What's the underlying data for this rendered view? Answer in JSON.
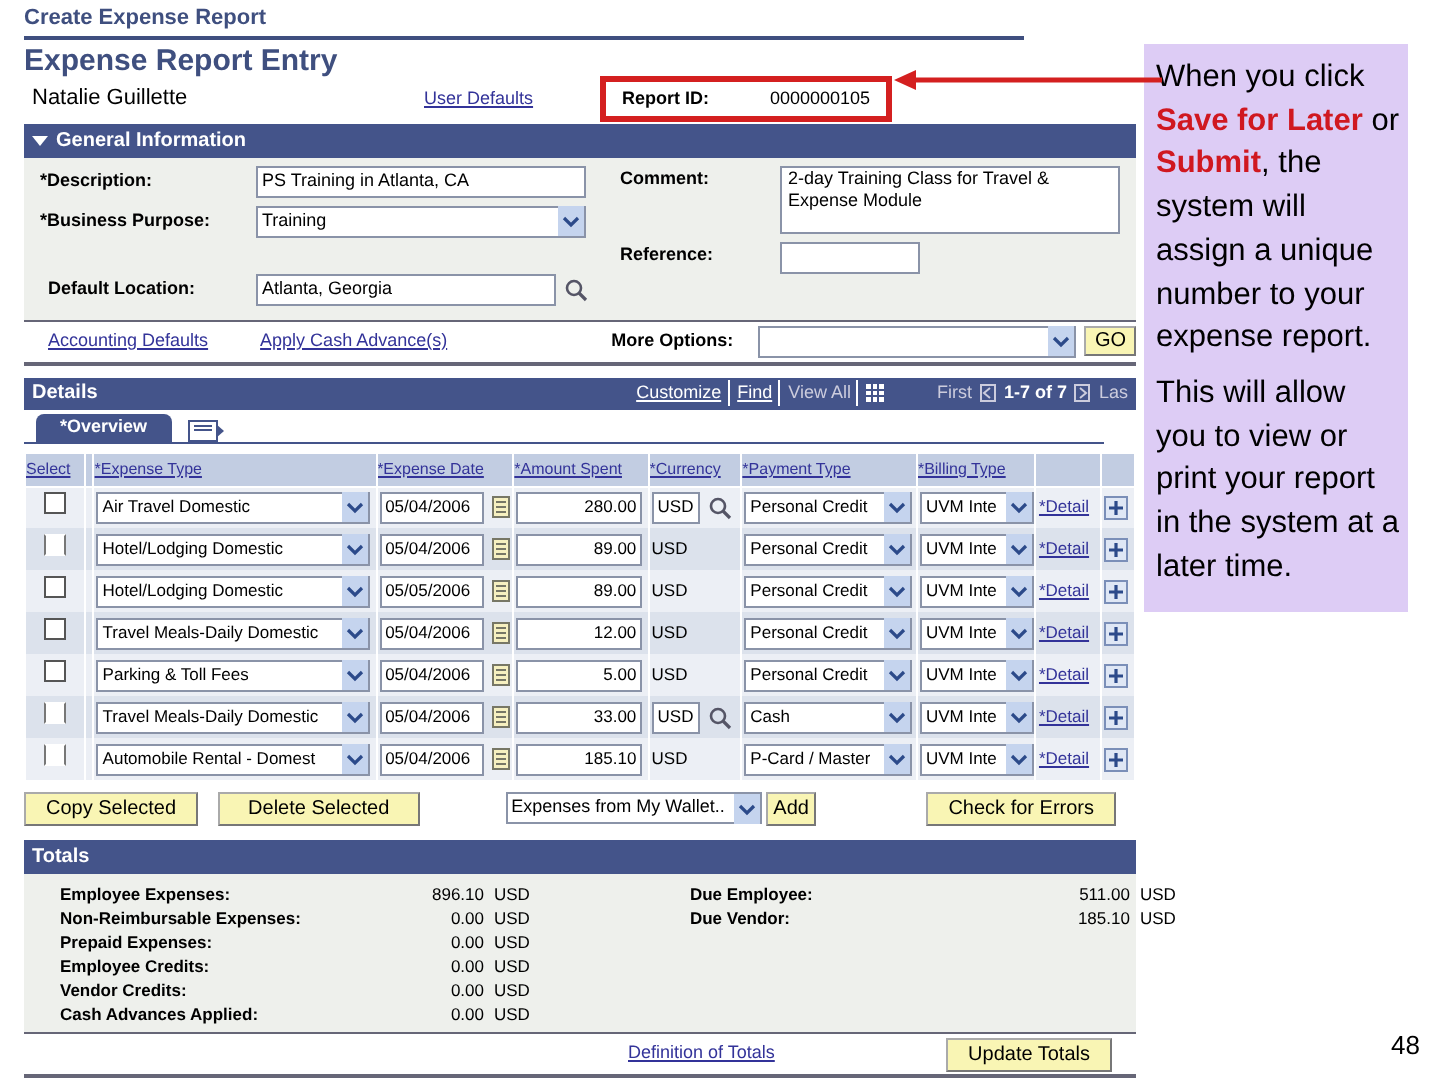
{
  "header": {
    "breadcrumb": "Create Expense Report",
    "title": "Expense Report Entry",
    "employee": "Natalie Guillette",
    "user_defaults": "User Defaults",
    "report_id_label": "Report ID:",
    "report_id": "0000000105"
  },
  "general": {
    "title": "General Information",
    "expanded": true,
    "description_label": "*Description:",
    "description": "PS Training in Atlanta, CA",
    "purpose_label": "*Business Purpose:",
    "purpose": "Training",
    "location_label": "Default Location:",
    "location": "Atlanta, Georgia",
    "comment_label": "Comment:",
    "comment": "2-day Training Class for Travel & Expense Module",
    "reference_label": "Reference:"
  },
  "options": {
    "links": [
      "Accounting Defaults",
      "Apply Cash Advance(s)"
    ],
    "more_options_label": "More Options:",
    "go": "GO"
  },
  "details": {
    "title": "Details",
    "nav": [
      "Customize",
      "Find",
      "View All"
    ],
    "first": "First",
    "range": "1-7 of 7",
    "last": "Las",
    "tabs": [
      {
        "label": "*Overview",
        "selected": true
      }
    ],
    "columns": [
      "Select",
      "*Expense Type",
      "*Expense Date",
      "*Amount Spent",
      "*Currency",
      "*Payment Type",
      "*Billing Type"
    ],
    "rows": [
      {
        "checked": false,
        "disabled": false,
        "type": "Air Travel Domestic",
        "date": "05/04/2006",
        "amount": "280.00",
        "currency": "USD",
        "currency_editable": true,
        "payment": "Personal Credit",
        "billing": "UVM Inte",
        "detail": "*Detail"
      },
      {
        "checked": false,
        "disabled": true,
        "type": "Hotel/Lodging Domestic",
        "date": "05/04/2006",
        "amount": "89.00",
        "currency": "USD",
        "currency_editable": false,
        "payment": "Personal Credit",
        "billing": "UVM Inte",
        "detail": "*Detail"
      },
      {
        "checked": false,
        "disabled": false,
        "type": "Hotel/Lodging Domestic",
        "date": "05/05/2006",
        "amount": "89.00",
        "currency": "USD",
        "currency_editable": false,
        "payment": "Personal Credit",
        "billing": "UVM Inte",
        "detail": "*Detail"
      },
      {
        "checked": false,
        "disabled": false,
        "type": "Travel Meals-Daily Domestic",
        "date": "05/04/2006",
        "amount": "12.00",
        "currency": "USD",
        "currency_editable": false,
        "payment": "Personal Credit",
        "billing": "UVM Inte",
        "detail": "*Detail"
      },
      {
        "checked": false,
        "disabled": false,
        "type": "Parking & Toll Fees",
        "date": "05/04/2006",
        "amount": "5.00",
        "currency": "USD",
        "currency_editable": false,
        "payment": "Personal Credit",
        "billing": "UVM Inte",
        "detail": "*Detail"
      },
      {
        "checked": false,
        "disabled": true,
        "type": "Travel Meals-Daily Domestic",
        "date": "05/04/2006",
        "amount": "33.00",
        "currency": "USD",
        "currency_editable": true,
        "payment": "Cash",
        "billing": "UVM Inte",
        "detail": "*Detail"
      },
      {
        "checked": false,
        "disabled": true,
        "type": "Automobile Rental - Domest",
        "date": "05/04/2006",
        "amount": "185.10",
        "currency": "USD",
        "currency_editable": false,
        "payment": "P-Card / Master",
        "billing": "UVM Inte",
        "detail": "*Detail"
      }
    ],
    "buttons": {
      "copy": "Copy Selected",
      "delete": "Delete Selected",
      "wallet": "Expenses from My Wallet..",
      "add": "Add",
      "check": "Check for Errors"
    }
  },
  "totals": {
    "title": "Totals",
    "left": [
      {
        "label": "Employee Expenses:",
        "amount": "896.10",
        "currency": "USD"
      },
      {
        "label": "Non-Reimbursable Expenses:",
        "amount": "0.00",
        "currency": "USD"
      },
      {
        "label": "Prepaid Expenses:",
        "amount": "0.00",
        "currency": "USD"
      },
      {
        "label": "Employee Credits:",
        "amount": "0.00",
        "currency": "USD"
      },
      {
        "label": "Vendor Credits:",
        "amount": "0.00",
        "currency": "USD"
      },
      {
        "label": "Cash Advances Applied:",
        "amount": "0.00",
        "currency": "USD"
      }
    ],
    "right": [
      {
        "label": "Due Employee:",
        "amount": "511.00",
        "currency": "USD"
      },
      {
        "label": "Due Vendor:",
        "amount": "185.10",
        "currency": "USD"
      }
    ],
    "definition_link": "Definition of Totals",
    "update": "Update Totals"
  },
  "callout": [
    "When you click **Save for Later** or **Submit**, the system will assign a unique number to your expense report.",
    "This will allow you to view or print your report in the system at a later time."
  ],
  "slide_number": "48"
}
